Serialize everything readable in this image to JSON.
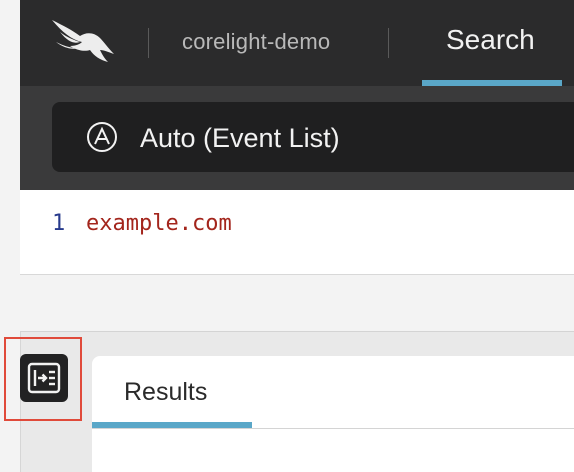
{
  "header": {
    "org_name": "corelight-demo",
    "active_tab": "Search",
    "tab_underline_color": "#5aa7c8"
  },
  "query_mode": {
    "icon_letter": "A",
    "label": "Auto (Event List)"
  },
  "editor": {
    "line_number": "1",
    "query": "example.com"
  },
  "results": {
    "tab_label": "Results"
  },
  "icons": {
    "logo": "falcon-logo-icon",
    "mode": "circled-a-icon",
    "chevron": "chevron-down-icon",
    "collapse": "expand-panel-icon"
  },
  "colors": {
    "highlight": "#e04a3a",
    "query_text": "#a3251c",
    "line_number": "#273a8c"
  }
}
